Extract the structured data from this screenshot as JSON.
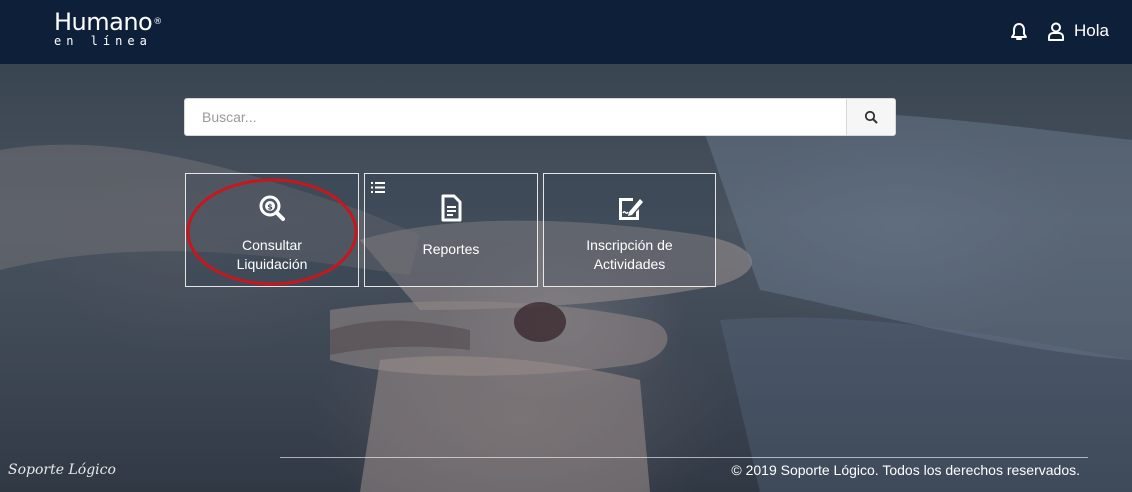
{
  "header": {
    "logo_main": "Humano",
    "logo_reg": "®",
    "logo_sub": "en línea",
    "greeting": "Hola"
  },
  "search": {
    "placeholder": "Buscar..."
  },
  "tiles": [
    {
      "line1": "Consultar",
      "line2": "Liquidación",
      "icon": "search-dollar-icon"
    },
    {
      "line1": "Reportes",
      "line2": "",
      "icon": "document-icon"
    },
    {
      "line1": "Inscripción de",
      "line2": "Actividades",
      "icon": "signature-icon"
    }
  ],
  "footer": {
    "brand": "Soporte Lógico",
    "copyright": "© 2019 Soporte Lógico. Todos los derechos reservados."
  },
  "colors": {
    "header_bg": "#0e2039",
    "highlight_circle": "#c8161d"
  }
}
